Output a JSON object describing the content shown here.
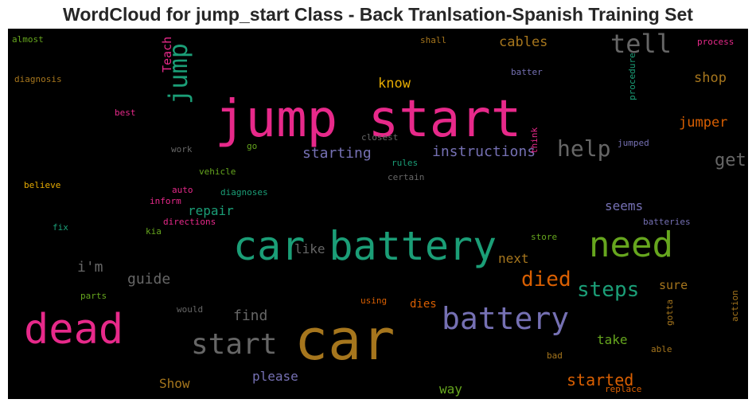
{
  "chart_data": {
    "type": "wordcloud",
    "title": "WordCloud for jump_start Class - Back Tranlsation-Spanish Training Set",
    "background": "#000000",
    "words": [
      {
        "text": "jump start",
        "color": "#e7298a",
        "weight": 1.0
      },
      {
        "text": "car battery",
        "color": "#1b9e77",
        "weight": 0.95
      },
      {
        "text": "car",
        "color": "#a6761d",
        "weight": 0.92
      },
      {
        "text": "dead",
        "color": "#e7298a",
        "weight": 0.8
      },
      {
        "text": "need",
        "color": "#66a61e",
        "weight": 0.72
      },
      {
        "text": "battery",
        "color": "#7570b3",
        "weight": 0.62
      },
      {
        "text": "start",
        "color": "#666666",
        "weight": 0.58
      },
      {
        "text": "tell",
        "color": "#666666",
        "weight": 0.5
      },
      {
        "text": "jump",
        "color": "#1b9e77",
        "weight": 0.5
      },
      {
        "text": "help",
        "color": "#666666",
        "weight": 0.44
      },
      {
        "text": "steps",
        "color": "#1b9e77",
        "weight": 0.42
      },
      {
        "text": "died",
        "color": "#d95f02",
        "weight": 0.4
      },
      {
        "text": "get",
        "color": "#666666",
        "weight": 0.34
      },
      {
        "text": "started",
        "color": "#d95f02",
        "weight": 0.32
      },
      {
        "text": "starting",
        "color": "#7570b3",
        "weight": 0.28
      },
      {
        "text": "instructions",
        "color": "#7570b3",
        "weight": 0.28
      },
      {
        "text": "know",
        "color": "#e6ab02",
        "weight": 0.26
      },
      {
        "text": "cables",
        "color": "#a6761d",
        "weight": 0.26
      },
      {
        "text": "shop",
        "color": "#a6761d",
        "weight": 0.26
      },
      {
        "text": "jumper",
        "color": "#d95f02",
        "weight": 0.26
      },
      {
        "text": "guide",
        "color": "#666666",
        "weight": 0.26
      },
      {
        "text": "i'm",
        "color": "#666666",
        "weight": 0.26
      },
      {
        "text": "repair",
        "color": "#1b9e77",
        "weight": 0.24
      },
      {
        "text": "seems",
        "color": "#7570b3",
        "weight": 0.24
      },
      {
        "text": "next",
        "color": "#a6761d",
        "weight": 0.24
      },
      {
        "text": "like",
        "color": "#666666",
        "weight": 0.24
      },
      {
        "text": "find",
        "color": "#666666",
        "weight": 0.25
      },
      {
        "text": "sure",
        "color": "#a6761d",
        "weight": 0.22
      },
      {
        "text": "take",
        "color": "#66a61e",
        "weight": 0.24
      },
      {
        "text": "dies",
        "color": "#d95f02",
        "weight": 0.22
      },
      {
        "text": "please",
        "color": "#7570b3",
        "weight": 0.24
      },
      {
        "text": "Show",
        "color": "#a6761d",
        "weight": 0.24
      },
      {
        "text": "way",
        "color": "#66a61e",
        "weight": 0.24
      },
      {
        "text": "Teach",
        "color": "#e7298a",
        "weight": 0.22
      },
      {
        "text": "procedure",
        "color": "#1b9e77",
        "weight": 0.16
      },
      {
        "text": "shall",
        "color": "#a6761d",
        "weight": 0.16
      },
      {
        "text": "process",
        "color": "#e7298a",
        "weight": 0.16
      },
      {
        "text": "almost",
        "color": "#66a61e",
        "weight": 0.16
      },
      {
        "text": "diagnosis",
        "color": "#a6761d",
        "weight": 0.16
      },
      {
        "text": "batter",
        "color": "#7570b3",
        "weight": 0.16
      },
      {
        "text": "best",
        "color": "#e7298a",
        "weight": 0.16
      },
      {
        "text": "closest",
        "color": "#666666",
        "weight": 0.16
      },
      {
        "text": "think",
        "color": "#e7298a",
        "weight": 0.16
      },
      {
        "text": "jumped",
        "color": "#7570b3",
        "weight": 0.16
      },
      {
        "text": "work",
        "color": "#666666",
        "weight": 0.16
      },
      {
        "text": "go",
        "color": "#66a61e",
        "weight": 0.16
      },
      {
        "text": "rules",
        "color": "#1b9e77",
        "weight": 0.16
      },
      {
        "text": "vehicle",
        "color": "#66a61e",
        "weight": 0.16
      },
      {
        "text": "certain",
        "color": "#666666",
        "weight": 0.16
      },
      {
        "text": "believe",
        "color": "#e6ab02",
        "weight": 0.16
      },
      {
        "text": "auto",
        "color": "#e7298a",
        "weight": 0.16
      },
      {
        "text": "diagnoses",
        "color": "#1b9e77",
        "weight": 0.16
      },
      {
        "text": "inform",
        "color": "#e7298a",
        "weight": 0.16
      },
      {
        "text": "batteries",
        "color": "#7570b3",
        "weight": 0.16
      },
      {
        "text": "directions",
        "color": "#e7298a",
        "weight": 0.16
      },
      {
        "text": "fix",
        "color": "#1b9e77",
        "weight": 0.16
      },
      {
        "text": "kia",
        "color": "#66a61e",
        "weight": 0.16
      },
      {
        "text": "store",
        "color": "#66a61e",
        "weight": 0.16
      },
      {
        "text": "parts",
        "color": "#66a61e",
        "weight": 0.16
      },
      {
        "text": "would",
        "color": "#666666",
        "weight": 0.16
      },
      {
        "text": "using",
        "color": "#d95f02",
        "weight": 0.16
      },
      {
        "text": "gotta",
        "color": "#a6761d",
        "weight": 0.16
      },
      {
        "text": "action",
        "color": "#a6761d",
        "weight": 0.16
      },
      {
        "text": "bad",
        "color": "#a6761d",
        "weight": 0.16
      },
      {
        "text": "able",
        "color": "#a6761d",
        "weight": 0.16
      },
      {
        "text": "replace",
        "color": "#d95f02",
        "weight": 0.16
      }
    ]
  }
}
